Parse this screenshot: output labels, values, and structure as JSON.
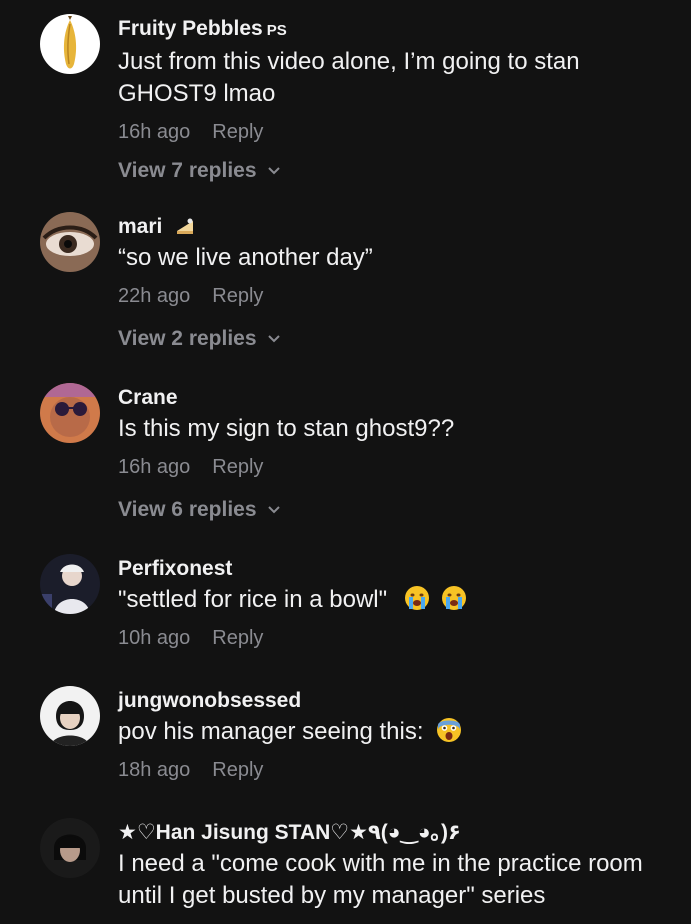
{
  "comments": [
    {
      "username": "Fruity Pebbles",
      "badge": "PS",
      "text": "Just from this video alone, I’m going to stan GHOST9 lmao",
      "time": "16h ago",
      "reply_label": "Reply",
      "view_replies": "View 7 replies",
      "avatar_icon": "banana-avatar"
    },
    {
      "username": "mari",
      "text": "“so we live another day”",
      "time": "22h ago",
      "reply_label": "Reply",
      "view_replies": "View 2 replies",
      "avatar_icon": "eye-closeup-avatar"
    },
    {
      "username": "Crane",
      "text": "Is this my sign to stan ghost9??",
      "time": "16h ago",
      "reply_label": "Reply",
      "view_replies": "View 6 replies",
      "avatar_icon": "sunglasses-avatar"
    },
    {
      "username": "Perfixonest",
      "text": "\"settled for rice in a bowl\"",
      "time": "10h ago",
      "reply_label": "Reply",
      "avatar_icon": "cap-person-avatar"
    },
    {
      "username": "jungwonobsessed",
      "text": "pov his manager seeing this:",
      "time": "18h ago",
      "reply_label": "Reply",
      "avatar_icon": "person-avatar"
    },
    {
      "username": "★♡Han Jisung STAN♡★٩(◕‿◕｡)۶",
      "text": "I need a \"come cook with me in the practice room until I get busted by my manager\" series",
      "avatar_icon": "dark-portrait-avatar"
    }
  ],
  "colors": {
    "background": "#121212",
    "primary_text": "#f1f1f2",
    "secondary_text": "#8a8b91"
  }
}
